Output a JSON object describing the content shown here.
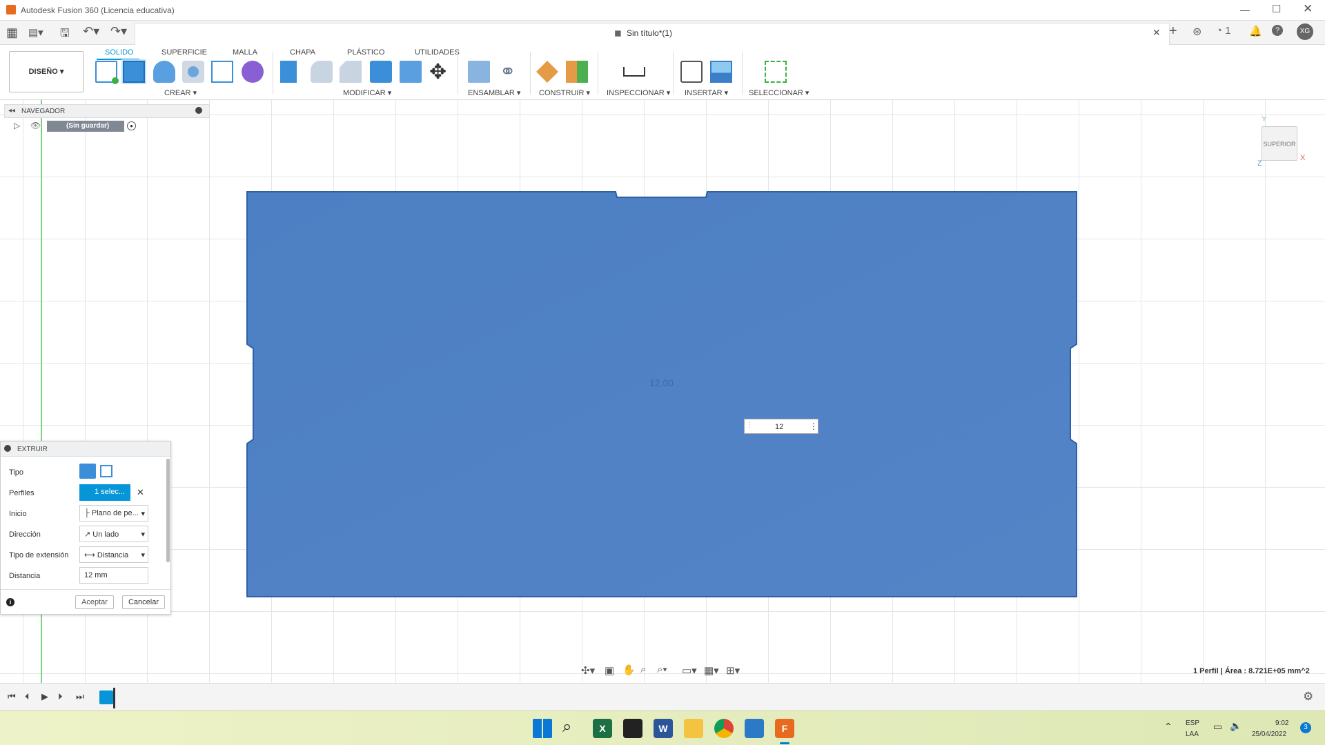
{
  "app": {
    "title": "Autodesk Fusion 360 (Licencia educativa)"
  },
  "document": {
    "tab_title": "Sin título*(1)"
  },
  "workspace": {
    "label": "DISEÑO"
  },
  "ribbon_tabs": [
    "SOLIDO",
    "SUPERFICIE",
    "MALLA",
    "CHAPA",
    "PLÁSTICO",
    "UTILIDADES"
  ],
  "groups": {
    "crear": "CREAR",
    "modificar": "MODIFICAR",
    "ensamblar": "ENSAMBLAR",
    "construir": "CONSTRUIR",
    "inspeccionar": "INSPECCIONAR",
    "insertar": "INSERTAR",
    "seleccionar": "SELECCIONAR"
  },
  "browser": {
    "title": "NAVEGADOR",
    "root": "(Sin guardar)"
  },
  "viewcube": {
    "face": "SUPERIOR",
    "x": "X",
    "y": "Y",
    "z": "Z"
  },
  "viewport": {
    "dimension_label": "12.00",
    "input_value": "12",
    "status": "1 Perfil | Área : 8.721E+05 mm^2"
  },
  "extrude": {
    "title": "EXTRUIR",
    "tipo_label": "Tipo",
    "perfiles_label": "Perfiles",
    "perfiles_value": "1 selec...",
    "inicio_label": "Inicio",
    "inicio_value": "Plano de pe...",
    "direccion_label": "Dirección",
    "direccion_value": "Un lado",
    "extension_label": "Tipo de extensión",
    "extension_value": "Distancia",
    "distancia_label": "Distancia",
    "distancia_value": "12 mm",
    "accept": "Aceptar",
    "cancel": "Cancelar"
  },
  "taskbar": {
    "lang": "ESP",
    "lang2": "LAA",
    "time": "9:02",
    "date": "25/04/2022",
    "notif": "3"
  },
  "colors": {
    "accent": "#0696d7",
    "sketch_fill": "#4d7fc4",
    "sketch_edge": "#2f5fa8",
    "y_axis": "#7cd37c"
  }
}
